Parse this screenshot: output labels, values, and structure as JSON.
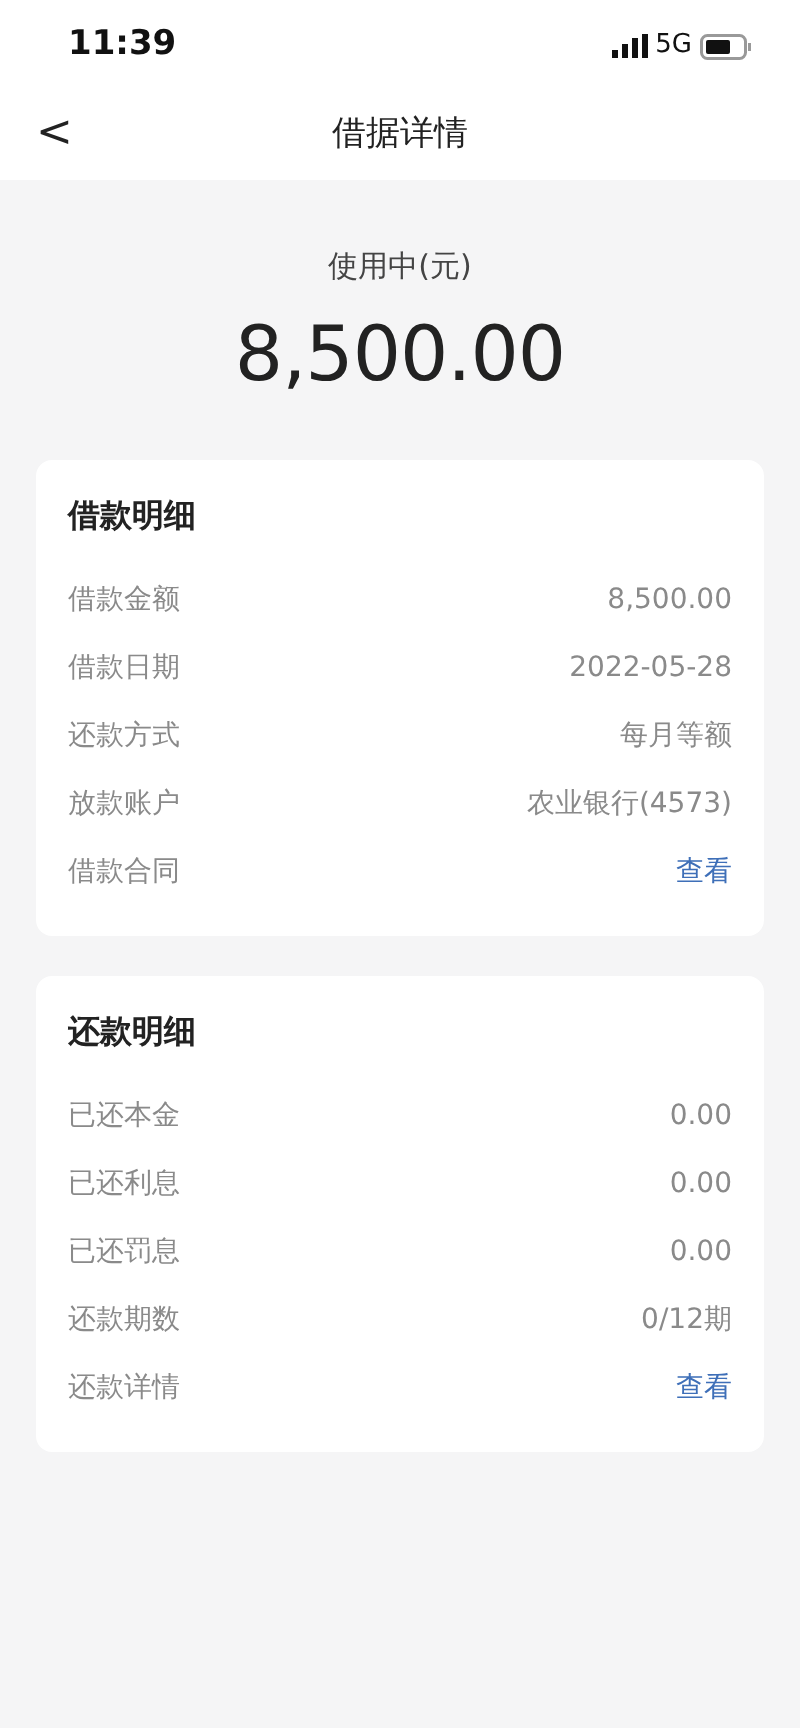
{
  "status_bar": {
    "time": "11:39",
    "network": "5G"
  },
  "nav": {
    "back": "<",
    "title": "借据详情"
  },
  "summary": {
    "label": "使用中(元)",
    "amount": "8,500.00"
  },
  "sections": [
    {
      "title": "借款明细",
      "rows": [
        {
          "label": "借款金额",
          "value": "8,500.00",
          "kind": "text"
        },
        {
          "label": "借款日期",
          "value": "2022-05-28",
          "kind": "text"
        },
        {
          "label": "还款方式",
          "value": "每月等额",
          "kind": "text"
        },
        {
          "label": "放款账户",
          "value": "农业银行(4573)",
          "kind": "text"
        },
        {
          "label": "借款合同",
          "value": "查看",
          "kind": "link"
        }
      ]
    },
    {
      "title": "还款明细",
      "rows": [
        {
          "label": "已还本金",
          "value": "0.00",
          "kind": "text"
        },
        {
          "label": "已还利息",
          "value": "0.00",
          "kind": "text"
        },
        {
          "label": "已还罚息",
          "value": "0.00",
          "kind": "text"
        },
        {
          "label": "还款期数",
          "value": "0/12期",
          "kind": "text"
        },
        {
          "label": "还款详情",
          "value": "查看",
          "kind": "link"
        }
      ]
    }
  ]
}
